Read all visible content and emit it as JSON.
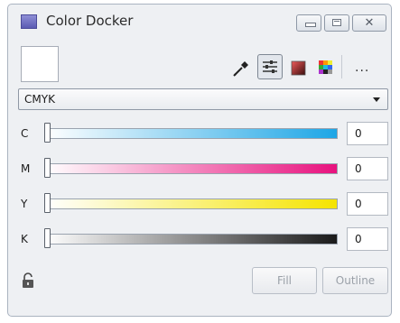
{
  "window": {
    "title": "Color Docker"
  },
  "toolbar": {
    "more_label": "..."
  },
  "model_dropdown": {
    "selected": "CMYK"
  },
  "channels": [
    {
      "label": "C",
      "value": "0",
      "gradient_end": "#1ea6e6"
    },
    {
      "label": "M",
      "value": "0",
      "gradient_end": "#e8127e"
    },
    {
      "label": "Y",
      "value": "0",
      "gradient_end": "#f5e400"
    },
    {
      "label": "K",
      "value": "0",
      "gradient_end": "#1a1a1a"
    }
  ],
  "buttons": {
    "fill": "Fill",
    "outline": "Outline"
  }
}
